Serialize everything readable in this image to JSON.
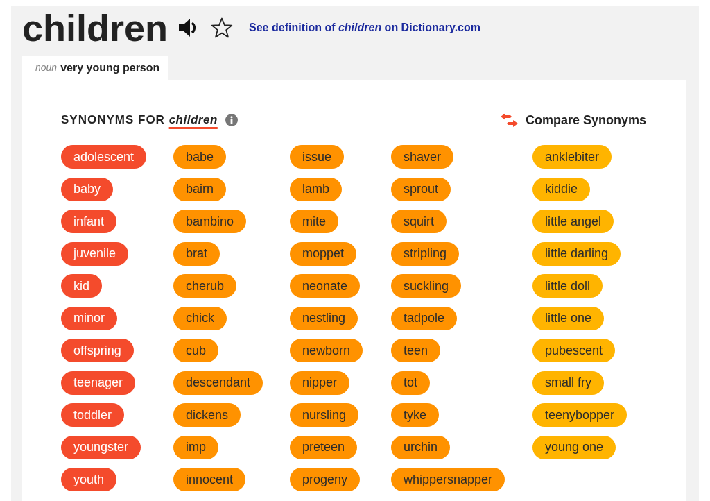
{
  "headword": "children",
  "dictionary_link": "See definition of *children* on Dictionary.com",
  "sense_tab": {
    "part_of_speech": "noun",
    "definition": "very young person",
    "selected": true
  },
  "synonyms_heading": {
    "label": "SYNONYMS FOR",
    "word": "children"
  },
  "compare_button": "Compare Synonyms",
  "columns": [
    {
      "color": "#f44b2c",
      "words": [
        "adolescent",
        "baby",
        "infant",
        "juvenile",
        "kid",
        "minor",
        "offspring",
        "teenager",
        "toddler",
        "youngster",
        "youth"
      ]
    },
    {
      "color": "#ff9200",
      "words": [
        "babe",
        "bairn",
        "bambino",
        "brat",
        "cherub",
        "chick",
        "cub",
        "descendant",
        "dickens",
        "imp",
        "innocent"
      ]
    },
    {
      "color": "#ff9200",
      "words": [
        "issue",
        "lamb",
        "mite",
        "moppet",
        "neonate",
        "nestling",
        "newborn",
        "nipper",
        "nursling",
        "preteen",
        "progeny"
      ]
    },
    {
      "color": "#ff9200",
      "words": [
        "shaver",
        "sprout",
        "squirt",
        "stripling",
        "suckling",
        "tadpole",
        "teen",
        "tot",
        "tyke",
        "urchin",
        "whippersnapper"
      ]
    },
    {
      "color": "#ffb400",
      "words": [
        "anklebiter",
        "kiddie",
        "little angel",
        "little darling",
        "little doll",
        "little one",
        "pubescent",
        "small fry",
        "teenybopper",
        "young one"
      ]
    }
  ]
}
